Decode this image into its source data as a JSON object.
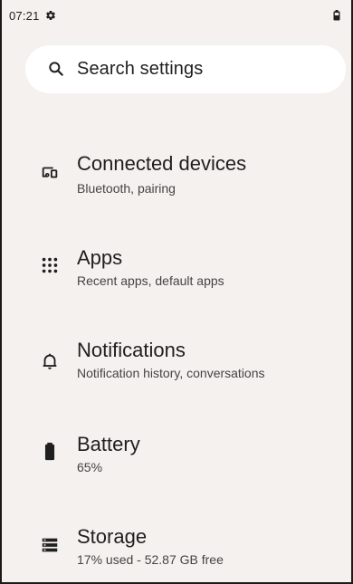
{
  "status_bar": {
    "time": "07:21",
    "icons": [
      "gear-icon",
      "battery-icon"
    ]
  },
  "search": {
    "placeholder": "Search settings",
    "icon": "search-icon"
  },
  "items": [
    {
      "title": "Connected devices",
      "subtitle": "Bluetooth, pairing",
      "icon": "connected-devices-icon"
    },
    {
      "title": "Apps",
      "subtitle": "Recent apps, default apps",
      "icon": "apps-grid-icon"
    },
    {
      "title": "Notifications",
      "subtitle": "Notification history, conversations",
      "icon": "bell-icon"
    },
    {
      "title": "Battery",
      "subtitle": "65%",
      "icon": "battery-icon"
    },
    {
      "title": "Storage",
      "subtitle": "17% used - 52.87 GB free",
      "icon": "storage-icon"
    }
  ],
  "colors": {
    "background": "#f4f1ef",
    "surface": "#ffffff",
    "text_primary": "#1f1f1f",
    "text_secondary": "#444444"
  }
}
